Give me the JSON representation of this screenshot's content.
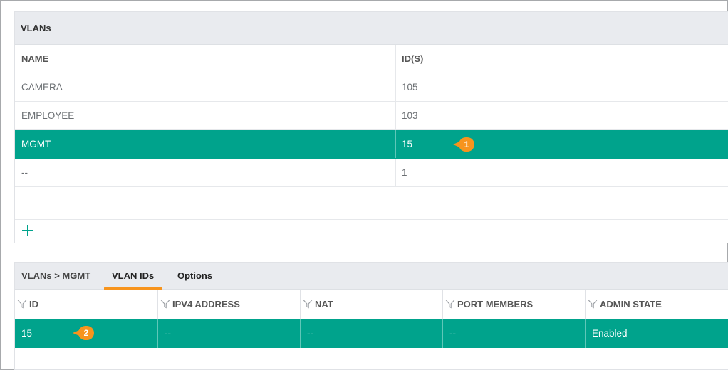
{
  "vlans_panel": {
    "title": "VLANs",
    "columns": [
      "NAME",
      "ID(S)"
    ],
    "rows": [
      {
        "name": "CAMERA",
        "ids": "105"
      },
      {
        "name": "EMPLOYEE",
        "ids": "103"
      },
      {
        "name": "MGMT",
        "ids": "15",
        "selected": true
      },
      {
        "name": "--",
        "ids": "1"
      }
    ],
    "add_icon": "plus-icon"
  },
  "detail_panel": {
    "breadcrumb": "VLANs > MGMT",
    "tabs": [
      {
        "label": "VLAN IDs",
        "active": true
      },
      {
        "label": "Options",
        "active": false
      }
    ],
    "columns": [
      "ID",
      "IPV4 ADDRESS",
      "NAT",
      "PORT MEMBERS",
      "ADMIN STATE"
    ],
    "filter_icon": "filter-icon",
    "rows": [
      {
        "id": "15",
        "ipv4": "--",
        "nat": "--",
        "port_members": "--",
        "admin_state": "Enabled"
      }
    ]
  },
  "callouts": [
    "1",
    "2"
  ],
  "colors": {
    "selected_row": "#00a38c",
    "accent": "#f7941d",
    "header_bg": "#e9ebef"
  }
}
